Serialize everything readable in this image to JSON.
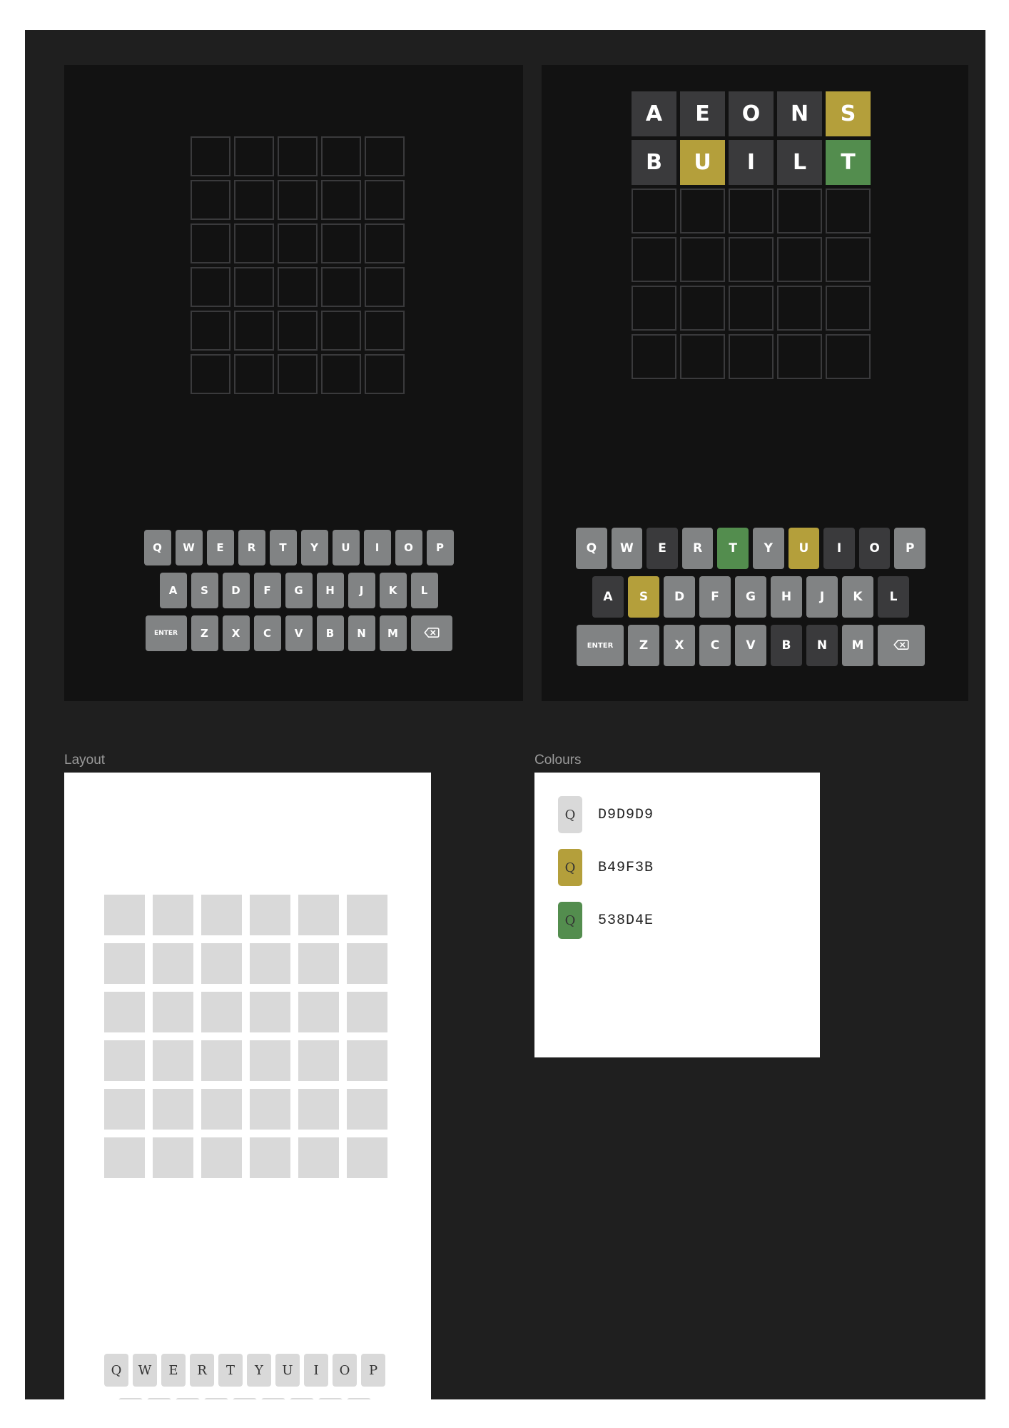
{
  "colors": {
    "canvas": "#1f1f1f",
    "frame": "#121212",
    "tile_border": "#3a3a3c",
    "absent": "#3a3a3c",
    "key_default": "#818384",
    "present": "#b49f3b",
    "correct": "#538d4e",
    "light": "#d9d9d9"
  },
  "empty_board": {
    "rows": 6,
    "cols": 5
  },
  "played_board": {
    "rows": [
      [
        {
          "letter": "A",
          "state": "absent"
        },
        {
          "letter": "E",
          "state": "absent"
        },
        {
          "letter": "O",
          "state": "absent"
        },
        {
          "letter": "N",
          "state": "absent"
        },
        {
          "letter": "S",
          "state": "present"
        }
      ],
      [
        {
          "letter": "B",
          "state": "absent"
        },
        {
          "letter": "U",
          "state": "present"
        },
        {
          "letter": "I",
          "state": "absent"
        },
        {
          "letter": "L",
          "state": "absent"
        },
        {
          "letter": "T",
          "state": "correct"
        }
      ],
      [
        {},
        {},
        {},
        {},
        {}
      ],
      [
        {},
        {},
        {},
        {},
        {}
      ],
      [
        {},
        {},
        {},
        {},
        {}
      ],
      [
        {},
        {},
        {},
        {},
        {}
      ]
    ]
  },
  "keyboard_default": {
    "rows": [
      [
        {
          "label": "Q"
        },
        {
          "label": "W"
        },
        {
          "label": "E"
        },
        {
          "label": "R"
        },
        {
          "label": "T"
        },
        {
          "label": "Y"
        },
        {
          "label": "U"
        },
        {
          "label": "I"
        },
        {
          "label": "O"
        },
        {
          "label": "P"
        }
      ],
      [
        {
          "label": "A"
        },
        {
          "label": "S"
        },
        {
          "label": "D"
        },
        {
          "label": "F"
        },
        {
          "label": "G"
        },
        {
          "label": "H"
        },
        {
          "label": "J"
        },
        {
          "label": "K"
        },
        {
          "label": "L"
        }
      ],
      [
        {
          "label": "ENTER",
          "wide": true
        },
        {
          "label": "Z"
        },
        {
          "label": "X"
        },
        {
          "label": "C"
        },
        {
          "label": "V"
        },
        {
          "label": "B"
        },
        {
          "label": "N"
        },
        {
          "label": "M"
        },
        {
          "label": "",
          "icon": "backspace-icon",
          "wide": true
        }
      ]
    ]
  },
  "keyboard_played": {
    "rows": [
      [
        {
          "label": "Q"
        },
        {
          "label": "W"
        },
        {
          "label": "E",
          "state": "absent"
        },
        {
          "label": "R"
        },
        {
          "label": "T",
          "state": "correct"
        },
        {
          "label": "Y"
        },
        {
          "label": "U",
          "state": "present"
        },
        {
          "label": "I",
          "state": "absent"
        },
        {
          "label": "O",
          "state": "absent"
        },
        {
          "label": "P"
        }
      ],
      [
        {
          "label": "A",
          "state": "absent"
        },
        {
          "label": "S",
          "state": "present"
        },
        {
          "label": "D"
        },
        {
          "label": "F"
        },
        {
          "label": "G"
        },
        {
          "label": "H"
        },
        {
          "label": "J"
        },
        {
          "label": "K"
        },
        {
          "label": "L",
          "state": "absent"
        }
      ],
      [
        {
          "label": "ENTER",
          "wide": true
        },
        {
          "label": "Z"
        },
        {
          "label": "X"
        },
        {
          "label": "C"
        },
        {
          "label": "V"
        },
        {
          "label": "B",
          "state": "absent"
        },
        {
          "label": "N",
          "state": "absent"
        },
        {
          "label": "M"
        },
        {
          "label": "",
          "icon": "backspace-icon",
          "wide": true
        }
      ]
    ]
  },
  "layout_section": {
    "label": "Layout",
    "grid_rows": 6,
    "grid_cols": 6,
    "keys": [
      "Q",
      "W",
      "E",
      "R",
      "T",
      "Y",
      "U",
      "I",
      "O",
      "P"
    ]
  },
  "colours_section": {
    "label": "Colours",
    "swatches": [
      {
        "letter": "Q",
        "code": "D9D9D9",
        "color": "#d9d9d9"
      },
      {
        "letter": "Q",
        "code": "B49F3B",
        "color": "#b49f3b"
      },
      {
        "letter": "Q",
        "code": "538D4E",
        "color": "#538d4e"
      }
    ]
  }
}
